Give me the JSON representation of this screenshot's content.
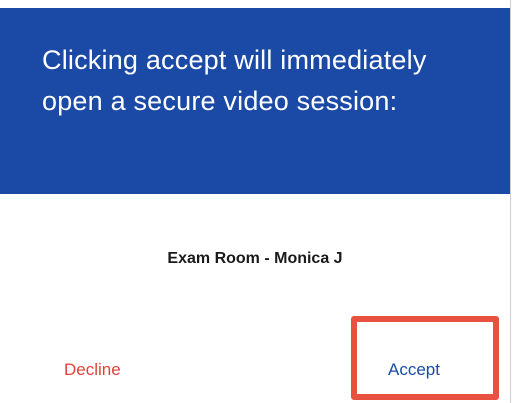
{
  "dialog": {
    "message": "Clicking accept will immediately open a secure video session:",
    "session_name": "Exam Room - Monica J",
    "decline_label": "Decline",
    "accept_label": "Accept"
  },
  "colors": {
    "header_background": "#1a4aa6",
    "decline_text": "#e0433a",
    "accept_text": "#1a4aa6",
    "highlight_border": "#e8513f"
  }
}
